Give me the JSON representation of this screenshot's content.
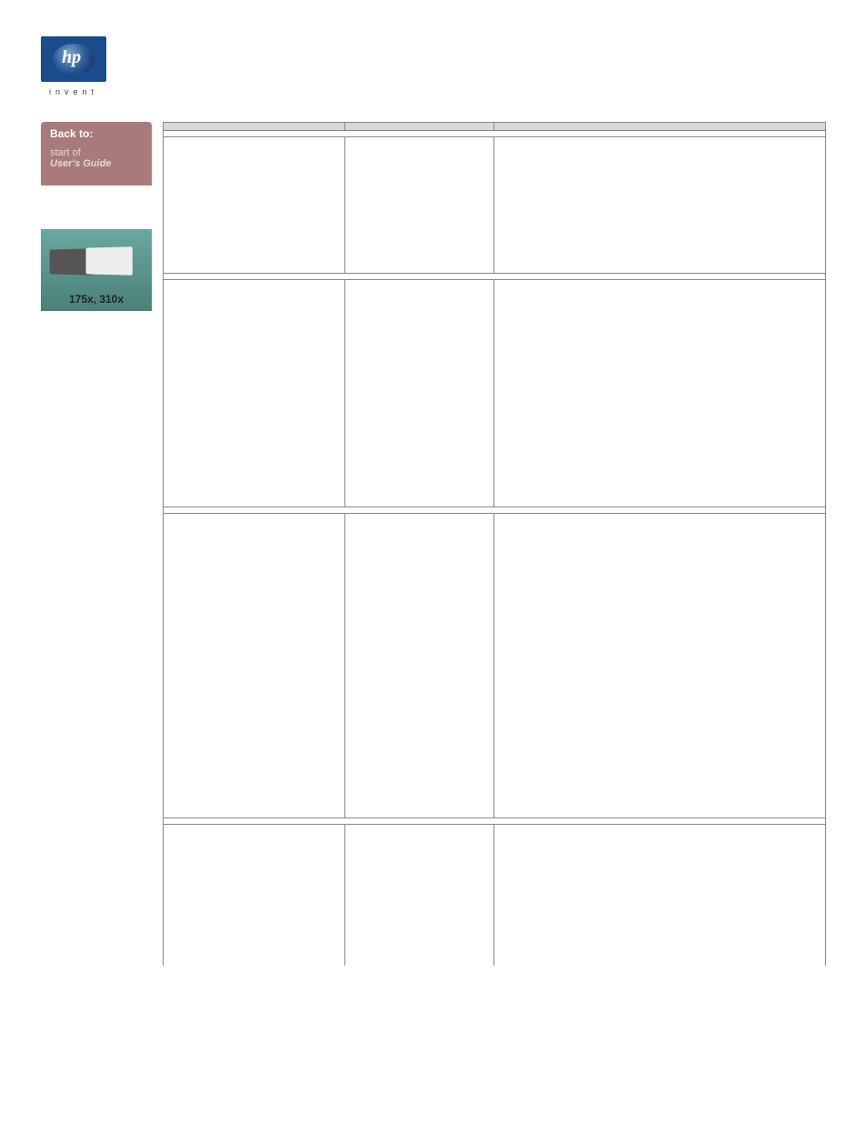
{
  "logo_text": "hp",
  "invent_text": "invent",
  "back_button": {
    "title": "Back to:",
    "line1": "start of",
    "line2": "User's Guide"
  },
  "product_label": "175x, 310x",
  "table": {
    "headers": [
      "",
      "",
      ""
    ],
    "sections": [
      {
        "link_text": " ",
        "rows": [
          {
            "c1": " ",
            "c2": " ",
            "c3": " ",
            "c3_link": " "
          }
        ]
      },
      {
        "link_text": " ",
        "rows": [
          {
            "c1": " ",
            "c2": " ",
            "c3": " ",
            "c3_link": " "
          }
        ]
      },
      {
        "link_text": " ",
        "rows": [
          {
            "c1": " ",
            "c2": " ",
            "c3": " ",
            "c3_link": " "
          }
        ]
      },
      {
        "link_text": " ",
        "rows": []
      }
    ]
  }
}
